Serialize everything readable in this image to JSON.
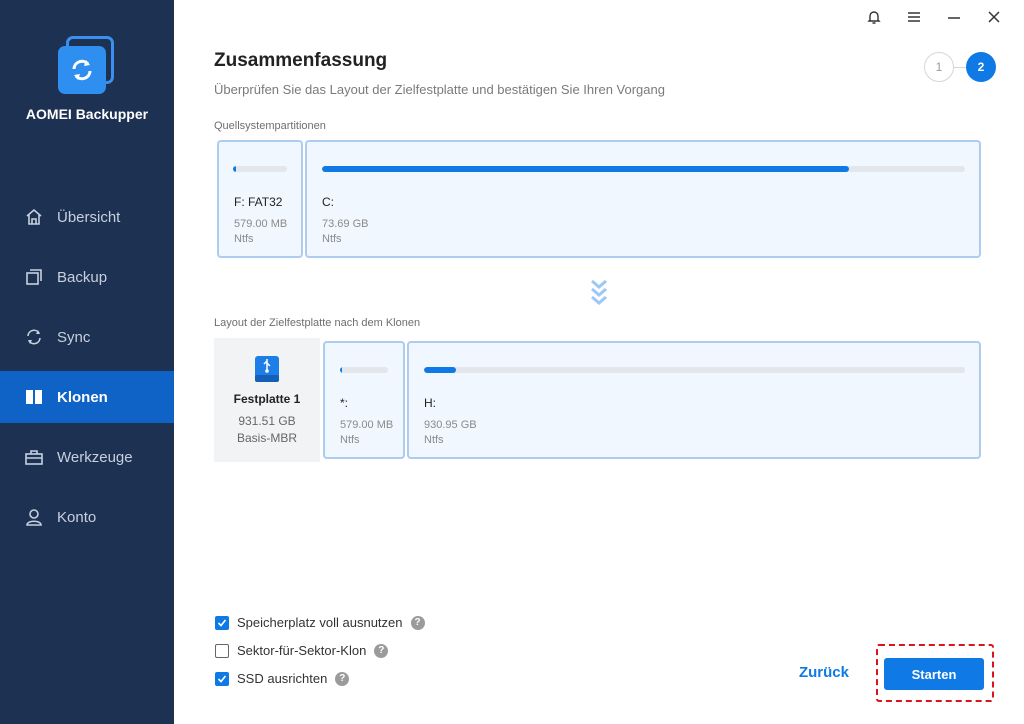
{
  "app": {
    "name": "AOMEI Backupper"
  },
  "sidebar": {
    "items": [
      {
        "label": "Übersicht",
        "icon": "home-icon",
        "active": false
      },
      {
        "label": "Backup",
        "icon": "copy-icon",
        "active": false
      },
      {
        "label": "Sync",
        "icon": "sync-icon",
        "active": false
      },
      {
        "label": "Klonen",
        "icon": "clone-icon",
        "active": true
      },
      {
        "label": "Werkzeuge",
        "icon": "toolbox-icon",
        "active": false
      },
      {
        "label": "Konto",
        "icon": "user-icon",
        "active": false
      }
    ]
  },
  "window": {
    "icons": [
      "bell-icon",
      "menu-icon",
      "minimize-icon",
      "close-icon"
    ]
  },
  "page": {
    "title": "Zusammenfassung",
    "subtitle": "Überprüfen Sie das Layout der Zielfestplatte und bestätigen Sie Ihren Vorgang",
    "steps": [
      "1",
      "2"
    ],
    "current_step": 2
  },
  "source": {
    "label": "Quellsystempartitionen",
    "partitions": [
      {
        "name": "F: FAT32",
        "size": "579.00 MB",
        "fs": "Ntfs",
        "used_fraction": 0.05
      },
      {
        "name": "C:",
        "size": "73.69 GB",
        "fs": "Ntfs",
        "used_fraction": 0.82
      }
    ]
  },
  "target": {
    "label": "Layout der Zielfestplatte nach dem Klonen",
    "disk": {
      "name": "Festplatte 1",
      "size": "931.51 GB",
      "type": "Basis-MBR",
      "icon": "usb-drive-icon"
    },
    "partitions": [
      {
        "name": "*:",
        "size": "579.00 MB",
        "fs": "Ntfs",
        "used_fraction": 0.05
      },
      {
        "name": "H:",
        "size": "930.95 GB",
        "fs": "Ntfs",
        "used_fraction": 0.06
      }
    ]
  },
  "options": [
    {
      "label": "Speicherplatz voll ausnutzen",
      "checked": true
    },
    {
      "label": "Sektor-für-Sektor-Klon",
      "checked": false
    },
    {
      "label": "SSD ausrichten",
      "checked": true
    }
  ],
  "help_glyph": "?",
  "buttons": {
    "back": "Zurück",
    "start": "Starten"
  },
  "colors": {
    "sidebar": "#1d3152",
    "accent": "#0f7ae5",
    "highlight": "#d9141b"
  }
}
